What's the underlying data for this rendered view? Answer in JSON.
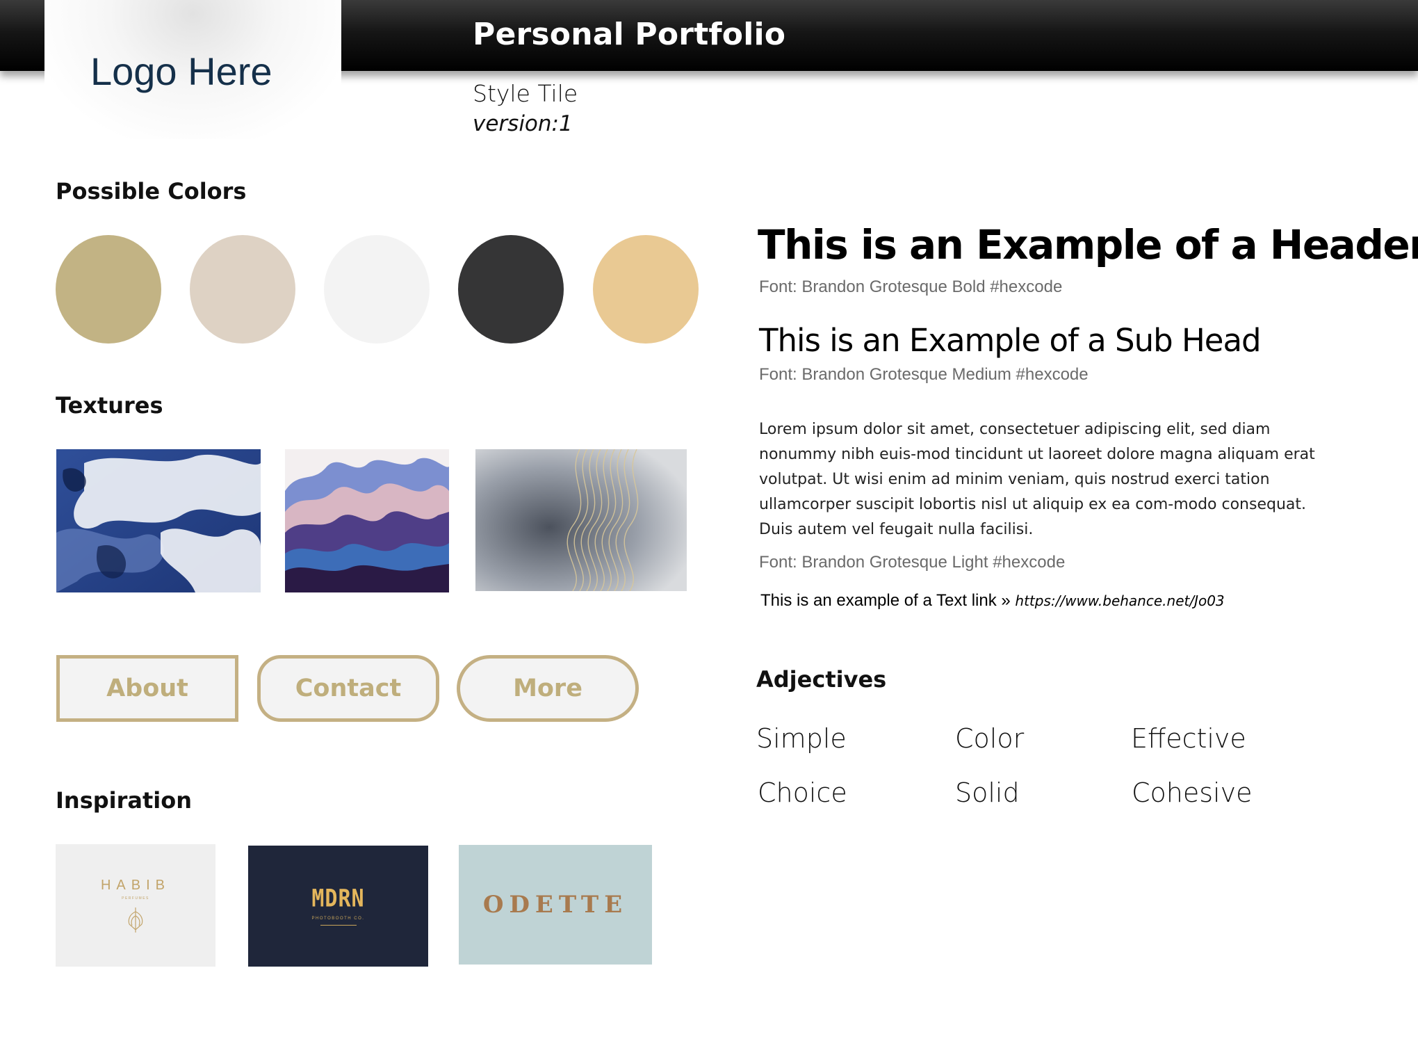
{
  "header": {
    "logo_text": "Logo Here",
    "title": "Personal Portfolio",
    "subtitle": "Style Tile",
    "version": "version:1"
  },
  "colors": {
    "heading": "Possible Colors",
    "swatches": [
      "#c2b384",
      "#ded2c4",
      "#f3f3f3",
      "#353536",
      "#e9c993"
    ]
  },
  "textures": {
    "heading": "Textures",
    "items": [
      "blue-ink-texture",
      "purple-mountain-texture",
      "grey-gold-texture"
    ]
  },
  "buttons": {
    "about": "About",
    "contact": "Contact",
    "more": "More",
    "accent": "#c4b083"
  },
  "inspiration": {
    "heading": "Inspiration",
    "items": [
      {
        "name": "HABIB",
        "tagline": "PERFUMES",
        "bg": "#efefef"
      },
      {
        "name": "MDRN",
        "tagline": "PHOTOBOOTH CO.",
        "bg": "#1f263a"
      },
      {
        "name": "ODETTE",
        "tagline": "",
        "bg": "#bfd3d5"
      }
    ]
  },
  "typography": {
    "header_example": "This is an Example of a Header",
    "header_font": "Font: Brandon Grotesque Bold #hexcode",
    "subhead_example": "This is an Example of a Sub Head",
    "subhead_font": "Font: Brandon Grotesque Medium #hexcode",
    "body_text": "Lorem ipsum dolor sit amet, consectetuer adipiscing elit, sed diam nonummy nibh euis-mod tincidunt ut laoreet dolore magna aliquam erat volutpat. Ut wisi enim ad minim veniam, quis nostrud exerci tation ullamcorper suscipit lobortis nisl ut aliquip ex ea com-modo consequat. Duis autem vel feugait nulla facilisi.",
    "body_font": "Font: Brandon Grotesque Light #hexcode",
    "link_label": "This is an example of a Text link »",
    "link_url": "https://www.behance.net/Jo03"
  },
  "adjectives": {
    "heading": "Adjectives",
    "words": [
      "Simple",
      "Color",
      "Effective",
      "Choice",
      "Solid",
      "Cohesive"
    ]
  }
}
